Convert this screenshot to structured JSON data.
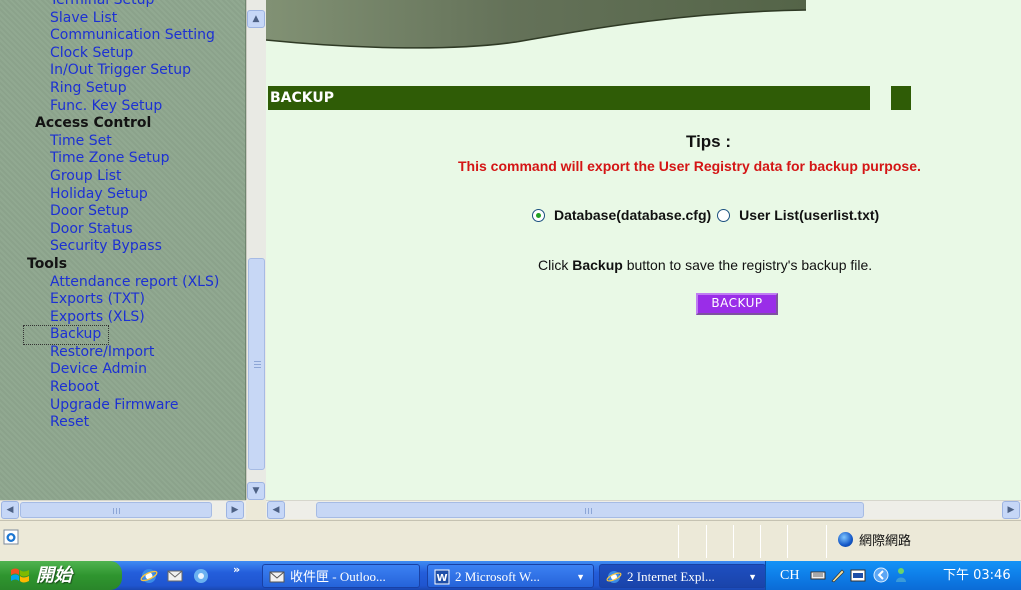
{
  "nav": {
    "items": [
      {
        "type": "link",
        "label": "Terminal Setup"
      },
      {
        "type": "link",
        "label": "Slave List"
      },
      {
        "type": "link",
        "label": "Communication Setting"
      },
      {
        "type": "link",
        "label": "Clock Setup"
      },
      {
        "type": "link",
        "label": "In/Out Trigger Setup"
      },
      {
        "type": "link",
        "label": "Ring Setup"
      },
      {
        "type": "link",
        "label": "Func. Key Setup"
      },
      {
        "type": "category",
        "label": "Access Control"
      },
      {
        "type": "link",
        "label": "Time Set"
      },
      {
        "type": "link",
        "label": "Time Zone Setup"
      },
      {
        "type": "link",
        "label": "Group List"
      },
      {
        "type": "link",
        "label": "Holiday Setup"
      },
      {
        "type": "link",
        "label": "Door Setup"
      },
      {
        "type": "link",
        "label": "Door Status"
      },
      {
        "type": "link",
        "label": "Security Bypass"
      },
      {
        "type": "category",
        "label": "Tools"
      },
      {
        "type": "link",
        "label": "Attendance report (XLS)"
      },
      {
        "type": "link",
        "label": "Exports (TXT)"
      },
      {
        "type": "link",
        "label": "Exports (XLS)"
      },
      {
        "type": "link",
        "label": "Backup"
      },
      {
        "type": "link",
        "label": "Restore/Import"
      },
      {
        "type": "link",
        "label": "Device Admin"
      },
      {
        "type": "link",
        "label": "Reboot"
      },
      {
        "type": "link",
        "label": "Upgrade Firmware"
      },
      {
        "type": "link",
        "label": "Reset"
      }
    ]
  },
  "main": {
    "section_title": "BACKUP",
    "tips_title": "Tips :",
    "tips_message": "This command will export the User Registry data for backup purpose.",
    "options": [
      {
        "label": "Database(database.cfg)",
        "checked": true
      },
      {
        "label": "User List(userlist.txt)",
        "checked": false
      }
    ],
    "instruction_prefix": "Click ",
    "instruction_bold": "Backup",
    "instruction_suffix": " button to save the registry's backup file.",
    "backup_button_label": "BACKUP"
  },
  "statusbar": {
    "zone_label": "網際網路"
  },
  "taskbar": {
    "start_label": "開始",
    "tasks": [
      {
        "label": "收件匣 - Outloo...",
        "active": false
      },
      {
        "label": "2 Microsoft W...",
        "active": false
      },
      {
        "label": "2 Internet Expl...",
        "active": true
      }
    ],
    "tray_lang": "CH",
    "clock": "下午 03:46"
  },
  "colors": {
    "nav_bg": "#8fa78f",
    "link": "#1b2fd6",
    "content_bg": "#e9f9e6",
    "header_bar": "#2f5c06",
    "tips_red": "#d41515",
    "button_purple": "#9a2de8",
    "taskbar_blue": "#245edb",
    "start_green": "#2f952f"
  }
}
